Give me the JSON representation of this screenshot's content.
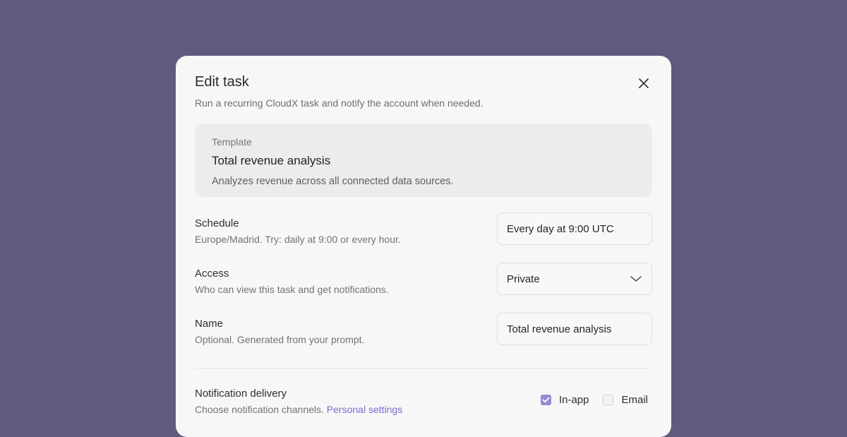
{
  "modal": {
    "title": "Edit task",
    "subtitle": "Run a recurring CloudX task and notify the account when needed."
  },
  "template": {
    "label": "Template",
    "title": "Total revenue analysis",
    "description": "Analyzes revenue across all connected data sources."
  },
  "schedule": {
    "label": "Schedule",
    "help": "Europe/Madrid. Try: daily at 9:00 or every hour.",
    "value": "Every day at 9:00 UTC"
  },
  "access": {
    "label": "Access",
    "help": "Who can view this task and get notifications.",
    "selected": "Private"
  },
  "name": {
    "label": "Name",
    "help": "Optional. Generated from your prompt.",
    "value": "Total revenue analysis"
  },
  "notifications": {
    "label": "Notification delivery",
    "help": "Choose notification channels.",
    "link": "Personal settings",
    "channels": [
      {
        "label": "In-app",
        "checked": true
      },
      {
        "label": "Email",
        "checked": false
      }
    ]
  },
  "colors": {
    "backdrop": "#625a7c",
    "accent": "#9b86d6",
    "link": "#7f6ac9"
  },
  "icons": {
    "close": "close-icon",
    "chevron": "chevron-down-icon",
    "check": "check-icon"
  }
}
